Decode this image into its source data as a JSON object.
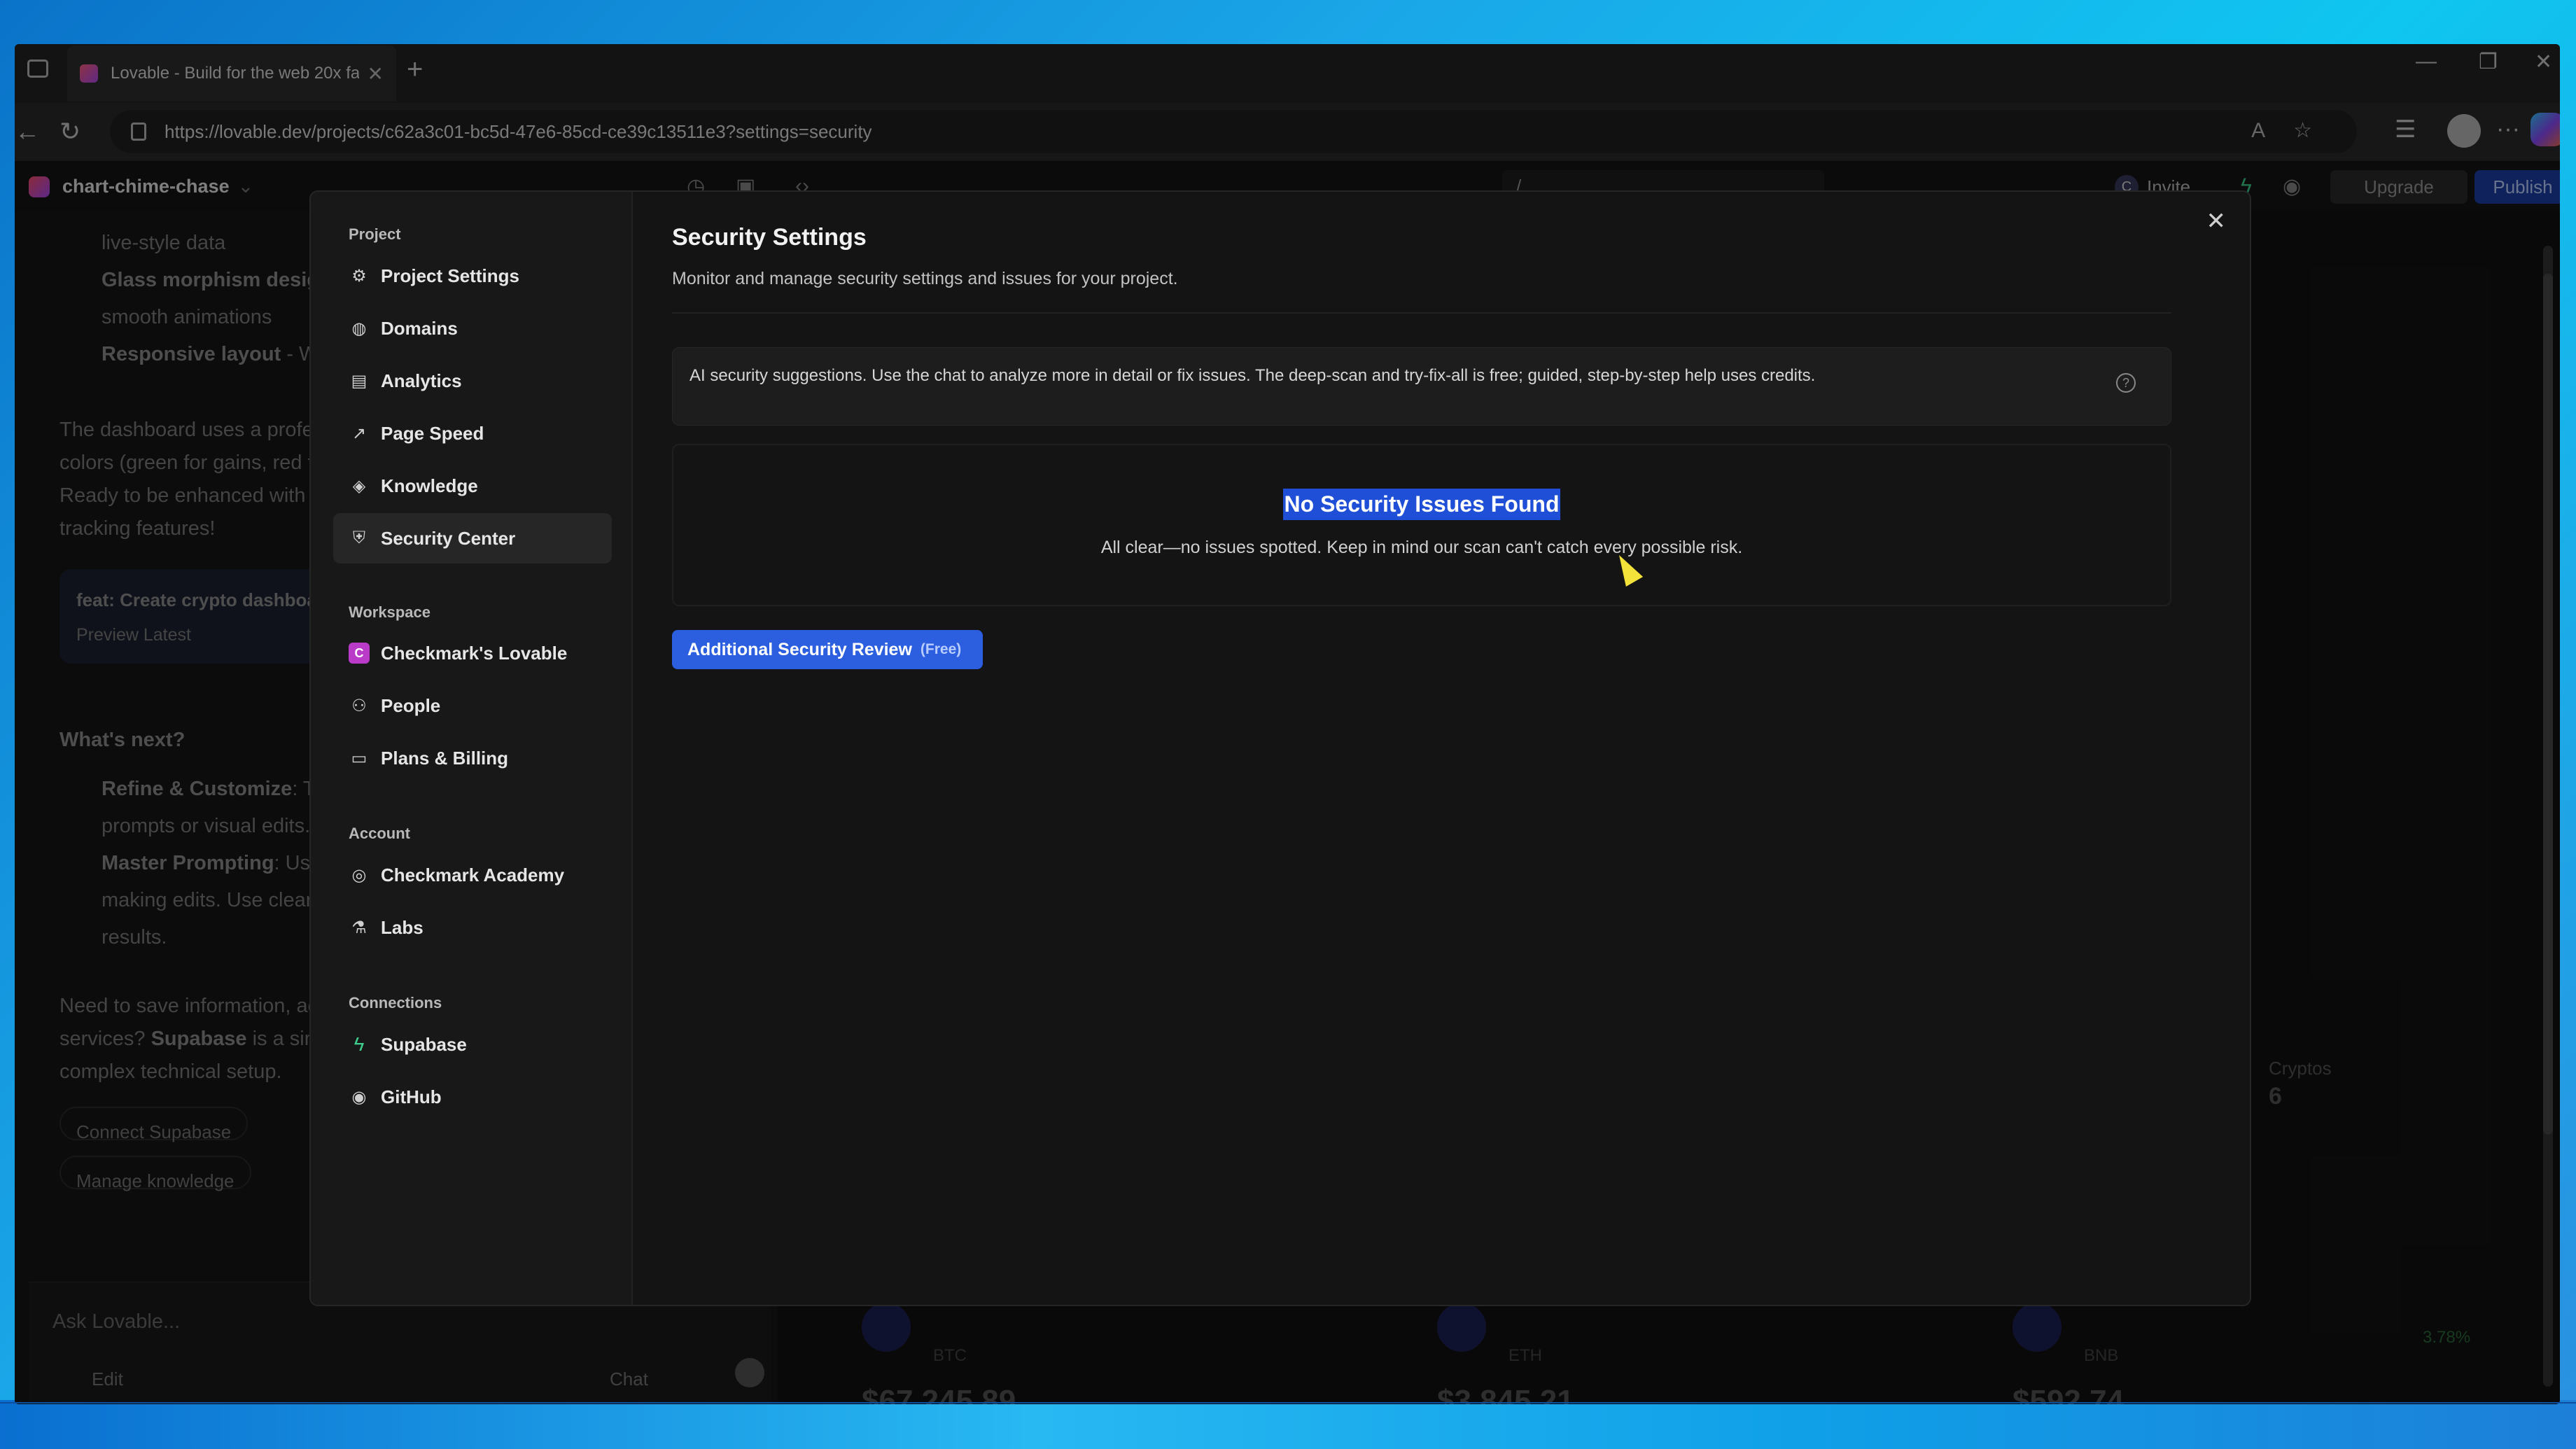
{
  "browser": {
    "tab_title": "Lovable - Build for the web 20x fa",
    "url": "https://lovable.dev/projects/c62a3c01-bc5d-47e6-85cd-ce39c13511e3?settings=security"
  },
  "app_header": {
    "project_name": "chart-chime-chase",
    "path": "/",
    "invite_initial": "C",
    "invite_label": "Invite",
    "upgrade_label": "Upgrade",
    "publish_label": "Publish"
  },
  "chat": {
    "lines": [
      "live-style data",
      "Glass morphism desig",
      "smooth animations",
      "Responsive layout",
      "- Wo",
      "The dashboard uses a profe",
      "colors (green for gains, red f",
      "Ready to be enhanced with r",
      "tracking features!",
      "feat: Create crypto dashboar",
      "Preview Latest",
      "What's next?",
      "Refine & Customize",
      ": Tv",
      "prompts or visual edits.",
      "Master Prompting",
      ": Use",
      "making edits. Use clear,",
      "results.",
      "Need to save information, ac",
      "services?",
      "Supabase",
      "is a sim",
      "complex technical setup."
    ],
    "chips": [
      "Connect Supabase",
      "Manage knowledge"
    ],
    "ask_placeholder": "Ask Lovable...",
    "edit_label": "Edit",
    "chat_label": "Chat"
  },
  "preview": {
    "coins": [
      {
        "symbol": "BTC",
        "price": "$67,245.89"
      },
      {
        "symbol": "ETH",
        "price": "$3,845.21"
      },
      {
        "symbol": "BNB",
        "price": "$592.74"
      }
    ],
    "side_label": "Cryptos",
    "side_value": "6",
    "change": "3.78%"
  },
  "modal": {
    "sections": {
      "project": "Project",
      "workspace": "Workspace",
      "account": "Account",
      "connections": "Connections"
    },
    "project_items": [
      {
        "label": "Project Settings",
        "icon": "gear-icon"
      },
      {
        "label": "Domains",
        "icon": "globe-icon"
      },
      {
        "label": "Analytics",
        "icon": "chart-icon"
      },
      {
        "label": "Page Speed",
        "icon": "trend-icon"
      },
      {
        "label": "Knowledge",
        "icon": "graduation-cap-icon"
      },
      {
        "label": "Security Center",
        "icon": "shield-icon",
        "active": true
      }
    ],
    "workspace_items": [
      {
        "label": "Checkmark's Lovable",
        "icon": "workspace-avatar-icon",
        "initial": "C"
      },
      {
        "label": "People",
        "icon": "people-icon"
      },
      {
        "label": "Plans & Billing",
        "icon": "credit-card-icon"
      }
    ],
    "account_items": [
      {
        "label": "Checkmark Academy",
        "icon": "user-circle-icon"
      },
      {
        "label": "Labs",
        "icon": "flask-icon"
      }
    ],
    "connection_items": [
      {
        "label": "Supabase",
        "icon": "supabase-icon"
      },
      {
        "label": "GitHub",
        "icon": "github-icon"
      }
    ],
    "title": "Security Settings",
    "subtitle": "Monitor and manage security settings and issues for your project.",
    "info_text": "AI security suggestions. Use the chat to analyze more in detail or fix issues. The deep-scan and try-fix-all is free; guided, step-by-step help uses credits.",
    "result_title": "No Security Issues Found",
    "result_sub": "All clear—no issues spotted. Keep in mind our scan can't catch every possible risk.",
    "button_label": "Additional Security Review",
    "button_badge": "(Free)"
  },
  "colors": {
    "accent": "#2b5fe0",
    "publish": "#1d3fa8",
    "selection": "#1f4fd6",
    "supabase": "#3ecf8e",
    "workspace_badge": "#b93bc8"
  }
}
